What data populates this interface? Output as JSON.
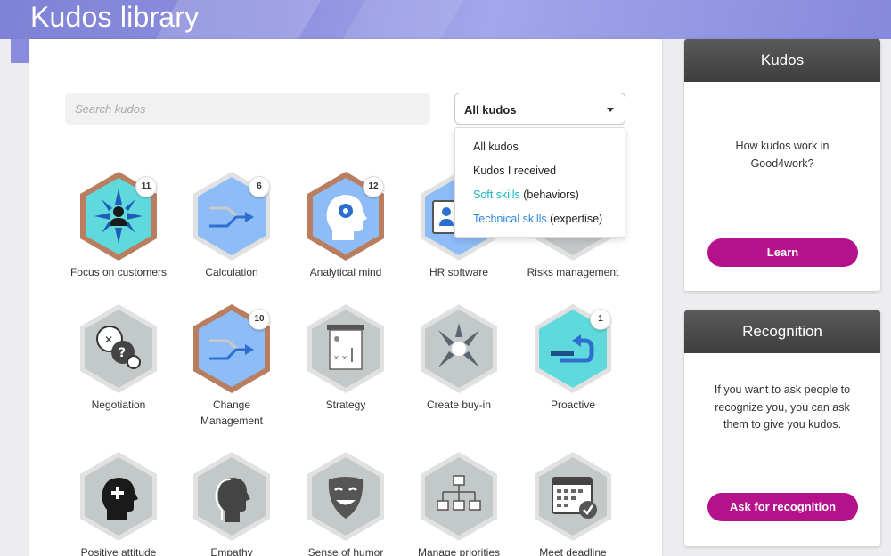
{
  "page": {
    "title": "Kudos library"
  },
  "search": {
    "placeholder": "Search kudos"
  },
  "filter": {
    "selected": "All kudos",
    "options": [
      {
        "label": "All kudos",
        "highlight": "",
        "rest": ""
      },
      {
        "label": "Kudos I received",
        "highlight": "",
        "rest": ""
      },
      {
        "label": "",
        "highlight": "Soft skills",
        "rest": " (behaviors)"
      },
      {
        "label": "",
        "highlight": "Technical skills",
        "rest": " (expertise)"
      }
    ]
  },
  "kudos": [
    {
      "name": "Focus on customers",
      "count": "11",
      "icon": "customer-focus-icon"
    },
    {
      "name": "Calculation",
      "count": "6",
      "icon": "merge-arrow-icon"
    },
    {
      "name": "Analytical mind",
      "count": "12",
      "icon": "head-gear-icon"
    },
    {
      "name": "HR software",
      "count": "",
      "icon": "id-card-icon"
    },
    {
      "name": "Risks management",
      "count": "",
      "icon": "risk-icon"
    },
    {
      "name": "Negotiation",
      "count": "",
      "icon": "speech-bubbles-icon"
    },
    {
      "name": "Change\nManagement",
      "count": "10",
      "icon": "merge-arrow-icon"
    },
    {
      "name": "Strategy",
      "count": "",
      "icon": "whiteboard-icon"
    },
    {
      "name": "Create buy-in",
      "count": "",
      "icon": "converging-arrows-icon"
    },
    {
      "name": "Proactive",
      "count": "1",
      "icon": "u-turn-arrow-icon"
    },
    {
      "name": "Positive attitude",
      "count": "",
      "icon": "positive-head-icon"
    },
    {
      "name": "Empathy",
      "count": "",
      "icon": "profile-head-icon"
    },
    {
      "name": "Sense of humor",
      "count": "",
      "icon": "smile-mask-icon"
    },
    {
      "name": "Manage priorities",
      "count": "",
      "icon": "org-chart-icon"
    },
    {
      "name": "Meet deadline",
      "count": "",
      "icon": "calendar-check-icon"
    }
  ],
  "sidebar": {
    "kudos_card": {
      "title": "Kudos",
      "text": "How kudos work in Good4work?",
      "button": "Learn"
    },
    "recognition_card": {
      "title": "Recognition",
      "text": "If you want to ask people to recognize you, you can ask them to give you kudos.",
      "button": "Ask for recognition"
    }
  },
  "colors": {
    "accent": "#b5118a",
    "header": "#8a8ddd",
    "badge_blue": "#8dbcf7",
    "badge_teal": "#5fd9dc",
    "badge_gray": "#c3c8c8",
    "frame_copper": "#b97d5f"
  }
}
